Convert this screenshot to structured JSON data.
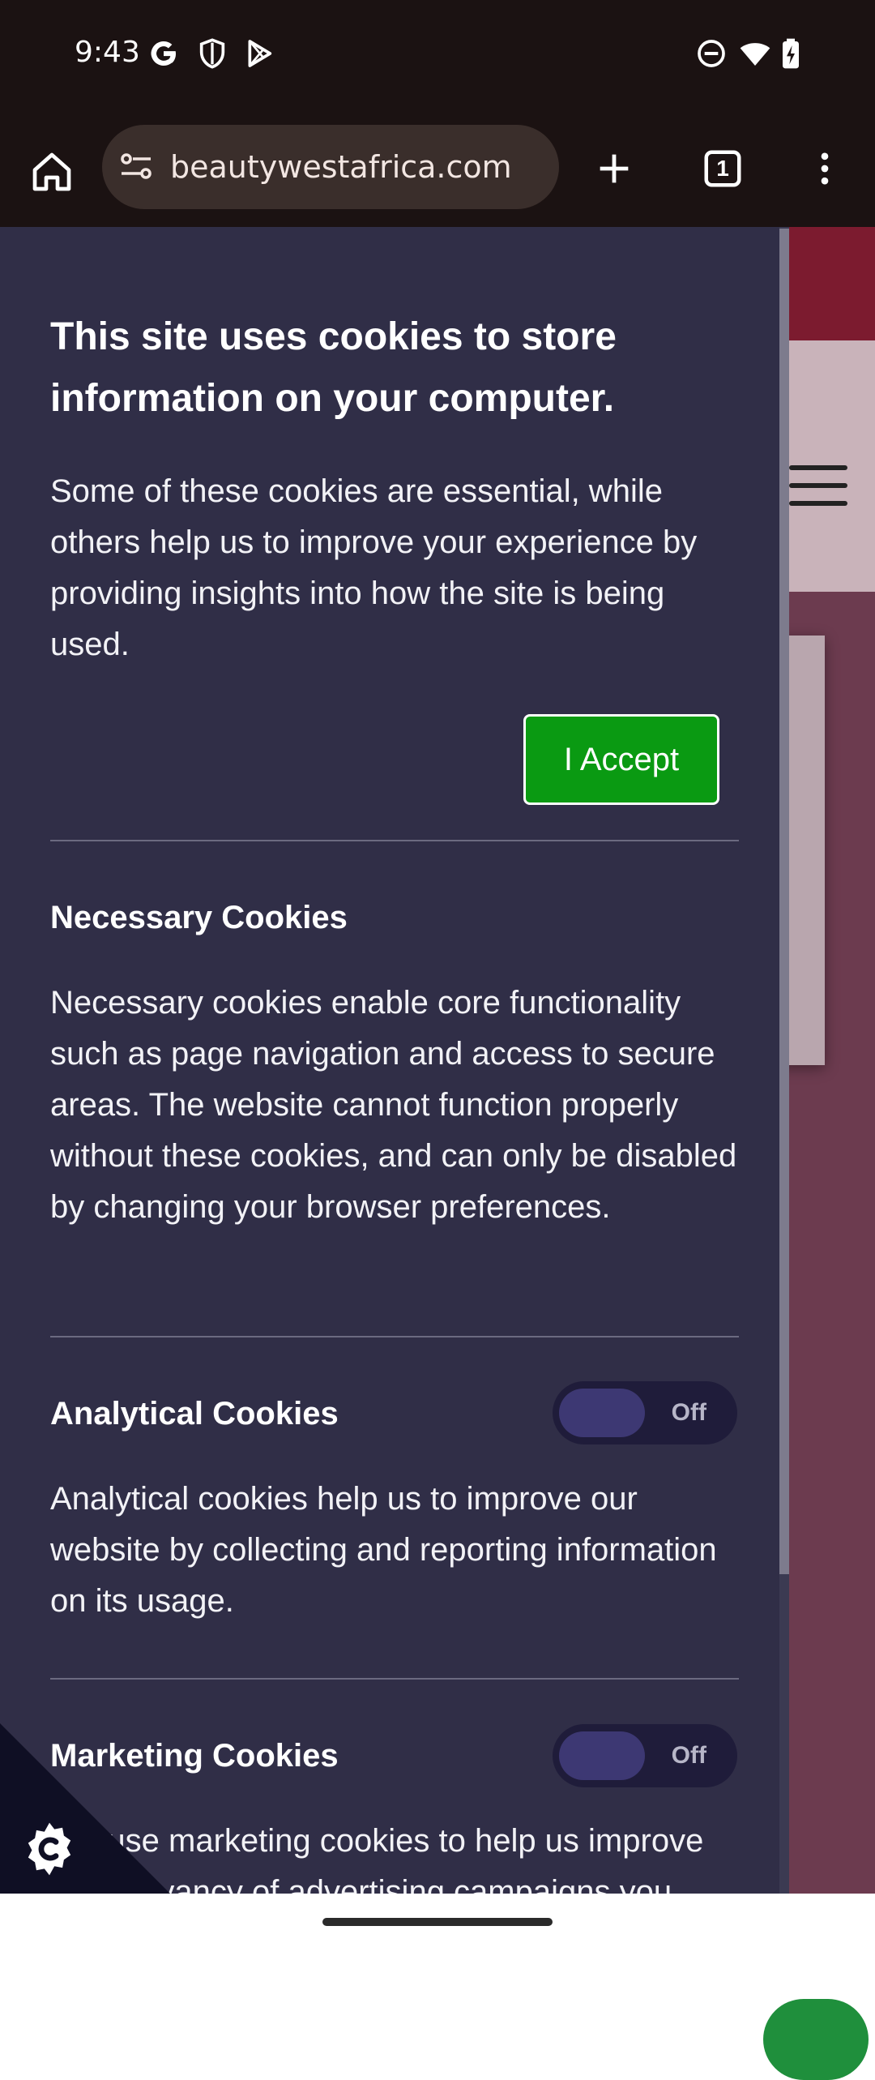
{
  "status_bar": {
    "time": "9:43",
    "left_icons": [
      "google-g-icon",
      "shield-icon",
      "play-store-icon"
    ],
    "right_icons": [
      "do-not-disturb-icon",
      "wifi-icon",
      "battery-charging-icon"
    ]
  },
  "browser": {
    "url": "beautywestafrica.com",
    "tab_count": "1",
    "icons": [
      "home-icon",
      "site-settings-icon",
      "new-tab-icon",
      "tab-switcher-icon",
      "more-menu-icon"
    ]
  },
  "cookie_panel": {
    "title": "This site uses cookies to store information on your computer.",
    "intro": "Some of these cookies are essential, while others help us to improve your experience by providing insights into how the site is being used.",
    "accept_label": "I Accept",
    "sections": [
      {
        "title": "Necessary Cookies",
        "body": "Necessary cookies enable core functionality such as page navigation and access to secure areas. The website cannot function properly without these cookies, and can only be disabled by changing your browser preferences."
      },
      {
        "title": "Analytical Cookies",
        "toggle": "Off",
        "body": "Analytical cookies help us to improve our website by collecting and reporting information on its usage."
      },
      {
        "title": "Marketing Cookies",
        "toggle": "Off",
        "body": "We use marketing cookies to help us improve the relevancy of advertising campaigns you"
      }
    ]
  },
  "colors": {
    "panel_bg": "#302e47",
    "accept_green": "#0a9a12",
    "toolbar_bg": "#1b1212",
    "toggle_knob": "#3d3873"
  }
}
